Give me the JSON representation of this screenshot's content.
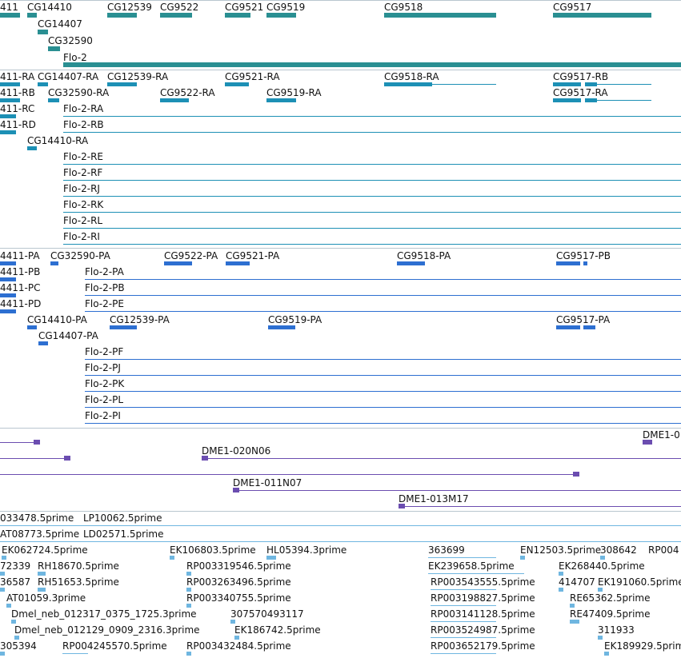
{
  "colors": {
    "gene": "#2a8f92",
    "transcript": "#1d90b5",
    "protein": "#2d6fd1",
    "bac": "#6b4db0",
    "est": "#6fb6e0",
    "separator": "#b9c6cf"
  },
  "tracks": {
    "genes": {
      "labels": [
        "411",
        "CG14410",
        "CG14407",
        "CG12539",
        "CG9522",
        "CG9521",
        "CG9519",
        "CG9518",
        "CG9517",
        "CG32590",
        "Flo-2"
      ]
    },
    "transcripts": {
      "labels": [
        "411-RA",
        "CG14407-RA",
        "CG12539-RA",
        "CG9521-RA",
        "CG9518-RA",
        "CG9517-RB",
        "411-RB",
        "CG32590-RA",
        "CG9522-RA",
        "CG9519-RA",
        "CG9517-RA",
        "411-RC",
        "Flo-2-RA",
        "411-RD",
        "Flo-2-RB",
        "CG14410-RA",
        "Flo-2-RE",
        "Flo-2-RF",
        "Flo-2-RJ",
        "Flo-2-RK",
        "Flo-2-RL",
        "Flo-2-RI"
      ]
    },
    "proteins": {
      "labels": [
        "4411-PA",
        "CG32590-PA",
        "CG9522-PA",
        "CG9521-PA",
        "CG9518-PA",
        "CG9517-PB",
        "4411-PB",
        "Flo-2-PA",
        "4411-PC",
        "Flo-2-PB",
        "4411-PD",
        "Flo-2-PE",
        "CG14410-PA",
        "CG12539-PA",
        "CG9519-PA",
        "CG9517-PA",
        "CG14407-PA",
        "Flo-2-PF",
        "Flo-2-PJ",
        "Flo-2-PK",
        "Flo-2-PL",
        "Flo-2-PI"
      ]
    },
    "bacs": {
      "labels": [
        "DME1-0",
        "DME1-020N06",
        "DME1-011N07",
        "DME1-013M17"
      ]
    },
    "ests": {
      "labels": [
        "033478.5prime",
        "LP10062.5prime",
        "AT08773.5prime",
        "LD02571.5prime",
        "EK062724.5prime",
        "EK106803.5prime",
        "HL05394.3prime",
        "363699",
        "EN12503.5prime",
        "308642",
        "RP004",
        "72339",
        "RH18670.5prime",
        "RP003319546.5prime",
        "EK239658.5prime",
        "EK268440.5prime",
        "36587",
        "RH51653.5prime",
        "RP003263496.5prime",
        "RP003543555.5prime",
        "414707",
        "EK191060.5prime",
        "AT01059.3prime",
        "RP003340755.5prime",
        "RP003198827.5prime",
        "RE65362.5prime",
        "Dmel_neb_012317_0375_1725.3prime",
        "307570493117",
        "RP003141128.5prime",
        "RE47409.5prime",
        "Dmel_neb_012129_0909_2316.3prime",
        "EK186742.5prime",
        "RP003524987.5prime",
        "311933",
        "305394",
        "RP004245570.5prime",
        "RP003432484.5prime",
        "RP003652179.5prime",
        "EK189929.5prime"
      ]
    }
  }
}
